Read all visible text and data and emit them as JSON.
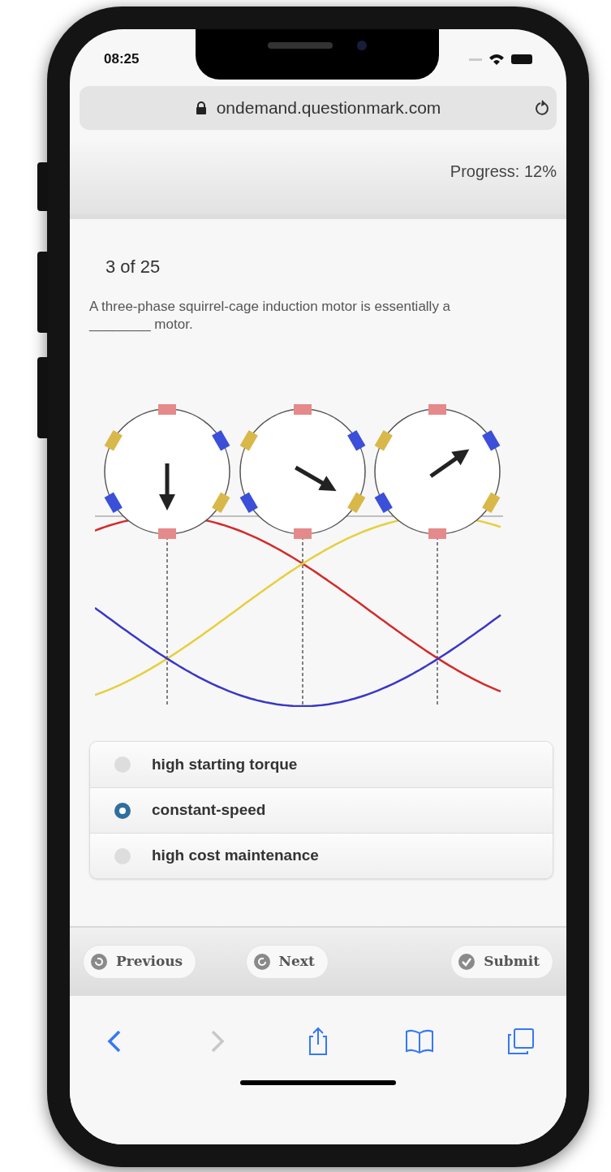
{
  "status_bar": {
    "time": "08:25"
  },
  "address_bar": {
    "url": "ondemand.questionmark.com"
  },
  "header": {
    "progress": "Progress: 12%"
  },
  "question": {
    "counter": "3 of 25",
    "text": "A three-phase squirrel-cage induction motor is essentially a ________ motor.",
    "options": [
      {
        "label": "high starting torque",
        "selected": false
      },
      {
        "label": "constant-speed",
        "selected": true
      },
      {
        "label": "high cost maintenance",
        "selected": false
      }
    ]
  },
  "navigation": {
    "buttons": [
      {
        "label": "Previous",
        "kind": "previous"
      },
      {
        "label": "Next",
        "kind": "next"
      },
      {
        "label": "Submit",
        "kind": "submit"
      }
    ]
  },
  "browser_toolbar": [
    {
      "kind": "back",
      "disabled": false
    },
    {
      "kind": "forward",
      "disabled": true
    },
    {
      "kind": "share",
      "disabled": false
    },
    {
      "kind": "bookmarks",
      "disabled": false
    },
    {
      "kind": "tabs",
      "disabled": false
    }
  ]
}
